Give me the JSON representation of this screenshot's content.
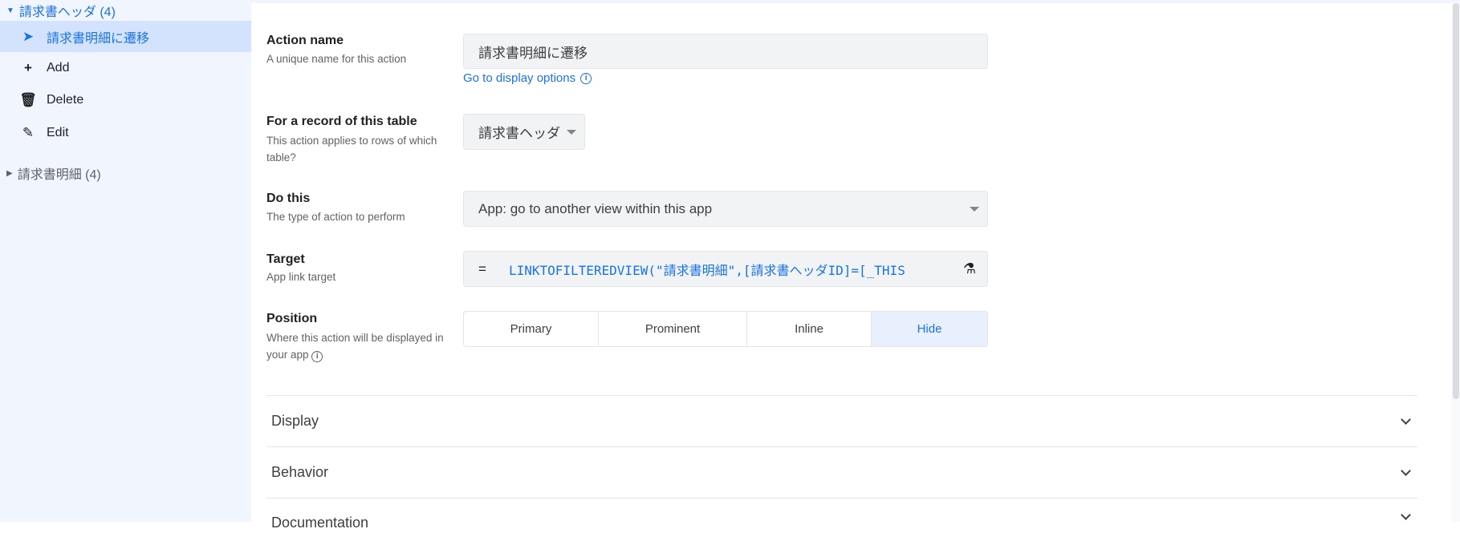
{
  "sidebar": {
    "group1": "請求書ヘッダ (4)",
    "selected": "請求書明細に遷移",
    "items": [
      {
        "label": "Add",
        "icon": "plus-icon"
      },
      {
        "label": "Delete",
        "icon": "trash-icon"
      },
      {
        "label": "Edit",
        "icon": "edit-icon"
      }
    ],
    "group2": "請求書明細 (4)"
  },
  "form": {
    "action_name": {
      "label": "Action name",
      "sub": "A unique name for this action",
      "value": "請求書明細に遷移",
      "link": "Go to display options"
    },
    "table": {
      "label": "For a record of this table",
      "sub": "This action applies to rows of which table?",
      "value": "請求書ヘッダ"
    },
    "do_this": {
      "label": "Do this",
      "sub": "The type of action to perform",
      "value": "App: go to another view within this app"
    },
    "target": {
      "label": "Target",
      "sub": "App link target",
      "eq": "=",
      "value": "LINKTOFILTEREDVIEW(\"請求書明細\",[請求書ヘッダID]=[_THIS"
    },
    "position": {
      "label": "Position",
      "sub": "Where this action will be displayed in your app",
      "options": [
        "Primary",
        "Prominent",
        "Inline",
        "Hide"
      ],
      "selected": "Hide"
    }
  },
  "sections": [
    "Display",
    "Behavior",
    "Documentation"
  ],
  "colors": {
    "accent": "#1a73e8",
    "selected_bg": "#d3e3fd"
  }
}
